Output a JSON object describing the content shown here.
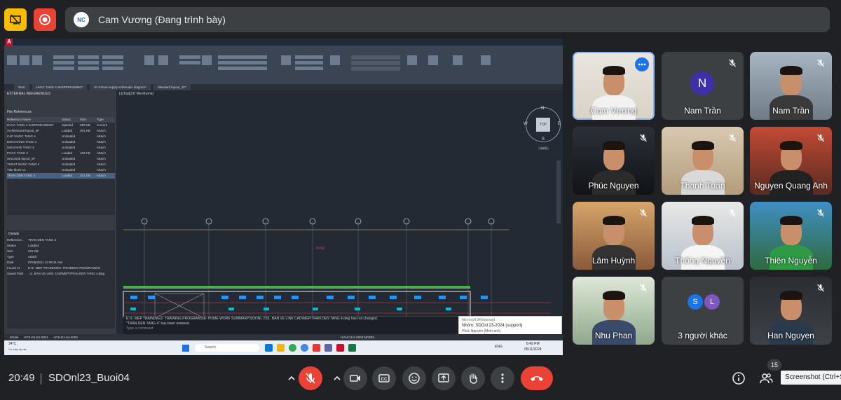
{
  "presenter_banner": {
    "name": "Cam Vương (Đang trình bày)",
    "avatar_text": "NC"
  },
  "shared_screen": {
    "ribbon_tabs": [
      "Home",
      "Insert",
      "Annotate",
      "Parametric",
      "View",
      "Manage",
      "Output",
      "Add-ins",
      "Collaborate",
      "Express Tools",
      "Featured Apps",
      "MEP",
      "DUCT",
      "UTILITY",
      "XREF SYMBOL",
      "VALVE",
      "Xem"
    ],
    "file_tabs": [
      "Start",
      "HVAC TANG 4-SHOPDRAWING*",
      "01-Fimair-supply-schematic diagram*",
      "Standard layout_1F*"
    ],
    "xref_title": "EXTERNAL REFERENCES",
    "file_refs_label": "File References",
    "xref_columns": [
      "Reference Name",
      "Status",
      "Size",
      "Type"
    ],
    "xref_rows": [
      [
        "HVAC TANG 4-SHOPDRAWING*",
        "Opened",
        "250 KB",
        "Current"
      ],
      [
        "Architectural layout_4F",
        "Loaded",
        "291 KB",
        "Attach"
      ],
      [
        "CAP NUOC TANG 4",
        "Unloaded",
        "",
        "Attach"
      ],
      [
        "DIEN NANG TANG 4",
        "Unloaded",
        "",
        "Attach"
      ],
      [
        "DIEN NHE TANG 4",
        "Unloaded",
        "",
        "Attach"
      ],
      [
        "PCCC TANG 4",
        "Loaded",
        "103 KB",
        "Attach"
      ],
      [
        "Structural layout_5F",
        "Unloaded",
        "",
        "Attach"
      ],
      [
        "THOAT NUOC TANG 4",
        "Unloaded",
        "",
        "Attach"
      ],
      [
        "Title block A1",
        "Unloaded",
        "",
        "Attach"
      ],
      [
        "TRAN DEN TANG 4",
        "Loaded",
        "221 KB",
        "Attach"
      ]
    ],
    "details_title": "Details",
    "details_rows": [
      [
        "Reference...",
        "TRAN DEN TANG 4"
      ],
      [
        "Status",
        "Loaded"
      ],
      [
        "Size",
        "221 KB"
      ],
      [
        "Type",
        "Attach"
      ],
      [
        "Date",
        "07/06/2021 11:09:31 AM"
      ],
      [
        "Found At",
        "E:\\1- MEP TRAINING\\2- TRAINING PROGRAMS\\3-"
      ],
      [
        "Saved Path",
        "..\\1. BAN VE LINK CAD\\MEP\\TRAN DEN TANG 4.dwg"
      ]
    ],
    "viewcube": {
      "top": "TOP",
      "n": "N",
      "s": "S",
      "e": "E",
      "w": "W",
      "wcs": "WCS"
    },
    "viewport_label": "[-][Top][2D Wireframe]",
    "command_lines": [
      "E:\\1- MEP TRAINING\\2- TRAINING PROGRAMS\\8- HOME WORK SUMMARY\\SDONL 23\\1. BAN VE LINK CAD\\MEP\\TRAN DEN TANG 4.dwg has not changed.",
      "\"TRAN DEN TANG 4\" has been restored."
    ],
    "command_placeholder": "Type a command",
    "layout_tabs": [
      "Model",
      "HTS-D1-54-2001",
      "HTS-D1-54-2000"
    ],
    "status_scale": "HVAC15.5.0000 MODEL",
    "taskbar": {
      "search": "Search",
      "weather_temp": "34°C",
      "weather_text": "Có mây rải rác",
      "lang": "ENG",
      "time": "8:49 PM",
      "date": "05/11/2024"
    },
    "notification": {
      "title": "Microsoft Whiteboard",
      "message": "Nhóm: SDOnl 23-2024 (support)",
      "sender": "Phúc Nguyên (Minh anh)"
    }
  },
  "participants": [
    {
      "name": "Cam Vương",
      "type": "video",
      "muted": false,
      "active": true
    },
    {
      "name": "Nam Trần",
      "type": "letter",
      "letter": "N",
      "muted": true
    },
    {
      "name": "Nam Trần",
      "type": "video",
      "muted": true
    },
    {
      "name": "Phúc Nguyen",
      "type": "video",
      "muted": true
    },
    {
      "name": "Thanh Tuấn",
      "type": "video",
      "muted": true
    },
    {
      "name": "Nguyen Quang Anh",
      "type": "video",
      "muted": true
    },
    {
      "name": "Lâm Huỳnh",
      "type": "video",
      "muted": true
    },
    {
      "name": "Thống Nguyễn",
      "type": "video",
      "muted": true
    },
    {
      "name": "Thiện Nguyễn",
      "type": "video",
      "muted": true
    },
    {
      "name": "Nhu Phan",
      "type": "video",
      "muted": true
    },
    {
      "name": "3 người khác",
      "type": "others",
      "avatars": [
        "S",
        "L"
      ]
    },
    {
      "name": "Han Nguyen",
      "type": "video",
      "muted": true
    }
  ],
  "bottom_bar": {
    "time": "20:49",
    "meeting_name": "SDOnl23_Buoi04",
    "participant_count": "15",
    "tooltip": "Screenshot (Ctrl+Shift+S)"
  },
  "colors": {
    "background": "#202124",
    "tile": "#3c4043",
    "end_call": "#ea4335",
    "mic_off": "#ea4335",
    "active_border": "#8ab4f8",
    "avatar_letter": "#3f2fa8"
  }
}
